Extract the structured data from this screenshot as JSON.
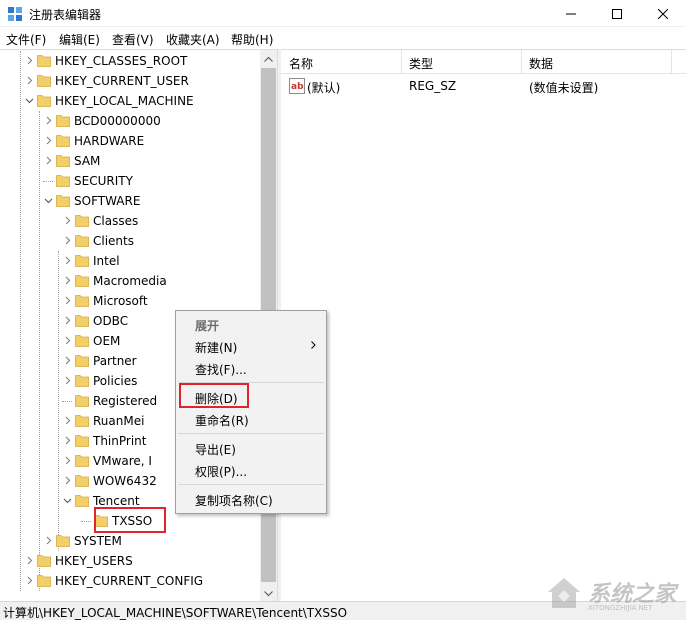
{
  "window": {
    "title": "注册表编辑器",
    "minimize_icon": "minimize-icon",
    "maximize_icon": "maximize-icon",
    "close_icon": "close-icon"
  },
  "menubar": {
    "items": [
      "文件(F)",
      "编辑(E)",
      "查看(V)",
      "收藏夹(A)",
      "帮助(H)"
    ]
  },
  "tree": {
    "items": [
      {
        "label": "HKEY_CLASSES_ROOT",
        "expander": "collapsed"
      },
      {
        "label": "HKEY_CURRENT_USER",
        "expander": "collapsed"
      },
      {
        "label": "HKEY_LOCAL_MACHINE",
        "expander": "expanded"
      },
      {
        "label": "BCD00000000",
        "expander": "collapsed"
      },
      {
        "label": "HARDWARE",
        "expander": "collapsed"
      },
      {
        "label": "SAM",
        "expander": "collapsed"
      },
      {
        "label": "SECURITY",
        "expander": "none"
      },
      {
        "label": "SOFTWARE",
        "expander": "expanded"
      },
      {
        "label": "Classes",
        "expander": "collapsed"
      },
      {
        "label": "Clients",
        "expander": "collapsed"
      },
      {
        "label": "Intel",
        "expander": "collapsed"
      },
      {
        "label": "Macromedia",
        "expander": "collapsed"
      },
      {
        "label": "Microsoft",
        "expander": "collapsed"
      },
      {
        "label": "ODBC",
        "expander": "collapsed"
      },
      {
        "label": "OEM",
        "expander": "collapsed"
      },
      {
        "label": "Partner",
        "expander": "collapsed"
      },
      {
        "label": "Policies",
        "expander": "collapsed"
      },
      {
        "label": "Registered",
        "expander": "none"
      },
      {
        "label": "RuanMei",
        "expander": "collapsed"
      },
      {
        "label": "ThinPrint",
        "expander": "collapsed"
      },
      {
        "label": "VMware, I",
        "expander": "collapsed"
      },
      {
        "label": "WOW6432",
        "expander": "collapsed"
      },
      {
        "label": "Tencent",
        "expander": "expanded"
      },
      {
        "label": "TXSSO",
        "expander": "none"
      },
      {
        "label": "SYSTEM",
        "expander": "collapsed"
      },
      {
        "label": "HKEY_USERS",
        "expander": "collapsed"
      },
      {
        "label": "HKEY_CURRENT_CONFIG",
        "expander": "collapsed"
      }
    ]
  },
  "list": {
    "columns": [
      "名称",
      "类型",
      "数据"
    ],
    "rows": [
      {
        "name": "(默认)",
        "type": "REG_SZ",
        "data": "(数值未设置)",
        "icon": "string-value-icon"
      }
    ]
  },
  "context_menu": {
    "items": [
      {
        "label": "展开",
        "bold": true
      },
      {
        "label": "新建(N)",
        "submenu": true
      },
      {
        "label": "查找(F)..."
      },
      {
        "label": "删除(D)",
        "highlighted": true
      },
      {
        "label": "重命名(R)"
      },
      {
        "label": "导出(E)"
      },
      {
        "label": "权限(P)..."
      },
      {
        "label": "复制项名称(C)"
      }
    ]
  },
  "statusbar": {
    "path": "计算机\\HKEY_LOCAL_MACHINE\\SOFTWARE\\Tencent\\TXSSO"
  },
  "watermark": {
    "text": "系统之家",
    "sub": "XITONGZHIJIA.NET"
  },
  "colors": {
    "highlight_red": "#e0242b",
    "folder_yellow": "#f3cf6a",
    "folder_dark": "#d9a93d"
  }
}
